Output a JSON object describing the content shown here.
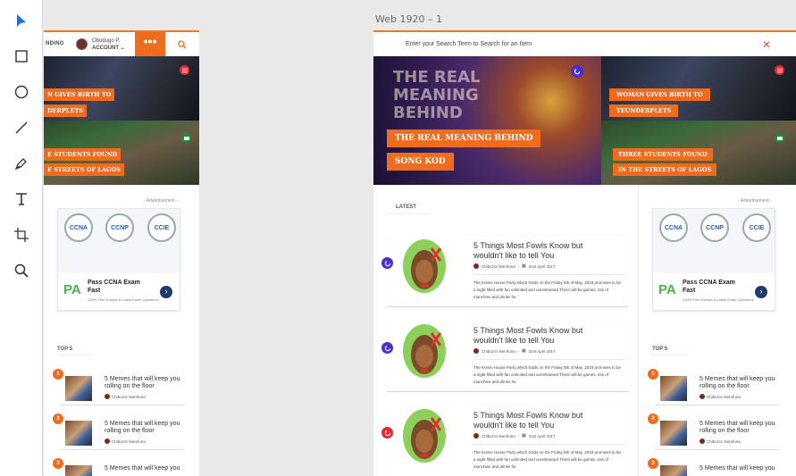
{
  "canvas": {
    "artboard_label": "Web 1920 – 1"
  },
  "tools": [
    "select-tool",
    "rectangle-tool",
    "ellipse-tool",
    "line-tool",
    "pen-tool",
    "text-tool",
    "artboard-tool",
    "zoom-tool"
  ],
  "colors": {
    "accent": "#ef6b1e",
    "header_border": "#ef7a1e",
    "badge_red": "#e8282b",
    "badge_green": "#1a8a3c",
    "badge_purple": "#4a2bd8"
  },
  "left_board": {
    "trending": "NDING",
    "user_name": "Obodugo P.",
    "account_label": "ACCOUNT",
    "more_label": "•••",
    "tiles": [
      {
        "line1": "N GIVES BIRTH TO",
        "line2": "DERPLETS"
      },
      {
        "line1": "E STUDENTS FOUND",
        "line2": "E STREETS OF LAGOS"
      }
    ],
    "ad_label": "- Advertisement -",
    "top5_label": "TOP 5",
    "top5": [
      {
        "num": "1",
        "title": "5 Memes that will keep you rolling on the floor",
        "author": "Chibuzor Ikemfuna"
      },
      {
        "num": "2",
        "title": "5 Memes that will keep you rolling on the floor",
        "author": "Chibuzor Ikemfuna"
      },
      {
        "num": "3",
        "title": "5 Memes that will keep you",
        "author": ""
      }
    ]
  },
  "ad": {
    "logos": [
      "CCNA",
      "CCNP",
      "CCIE"
    ],
    "brand": "PA",
    "title": "Pass CCNA Exam Fast",
    "subtitle": "100% Free Dumps & Latest Exam Questions",
    "arrow": "›"
  },
  "main_board": {
    "search_placeholder": "Enter your Search Term to Search for an Item",
    "close_label": "✕",
    "hero": {
      "title_bg": "THE REAL MEANING BEHIND",
      "tag1": "THE REAL MEANING BEHIND",
      "tag2": "SONG KOD"
    },
    "side_tiles": [
      {
        "line1": "WOMAN GIVES BIRTH TO",
        "line2": "TEUNDERPLETS"
      },
      {
        "line1": "THREE STUDENTS FOUND",
        "line2": "IN THE STREETS OF LAGOS"
      }
    ],
    "latest_label": "LATEST",
    "articles": [
      {
        "title": "5 Things Most Fowls Know but wouldn't like to tell You",
        "author": "Chibuzor Ikemfuna",
        "date": "31st April 2017",
        "excerpt": "The Kreiss House Party which holds on the Friday 5th of May, 2018 promises to be a night filled with fun unlimited and unrestrained There will be games, lots of munchies and drinks for",
        "badge_color": "#4a2bd8"
      },
      {
        "title": "5 Things Most Fowls Know but wouldn't like to tell You",
        "author": "Chibuzor Ikemfuna",
        "date": "31st April 2017",
        "excerpt": "The Kreiss House Party which holds on the Friday 5th of May, 2018 promises to be a night filled with fun unlimited and unrestrained There will be games, lots of munchies and drinks for",
        "badge_color": "#4a2bd8"
      },
      {
        "title": "5 Things Most Fowls Know but wouldn't like to tell You",
        "author": "Chibuzor Ikemfuna",
        "date": "31st April 2017",
        "excerpt": "The Kreiss House Party which holds on the Friday 5th of May, 2018 promises to be a night filled with fun unlimited and unrestrained There will be games, lots of munchies and drinks for",
        "badge_color": "#e8282b"
      }
    ],
    "ad_label": "- Advertisement -",
    "top5_label": "TOP 5",
    "top5": [
      {
        "num": "1",
        "title": "5 Memes that will keep you rolling on the floor",
        "author": "Chibuzor Ikemfuna"
      },
      {
        "num": "2",
        "title": "5 Memes that will keep you rolling on the floor",
        "author": "Chibuzor Ikemfuna"
      },
      {
        "num": "3",
        "title": "5 Memes that will keep you",
        "author": ""
      }
    ]
  }
}
